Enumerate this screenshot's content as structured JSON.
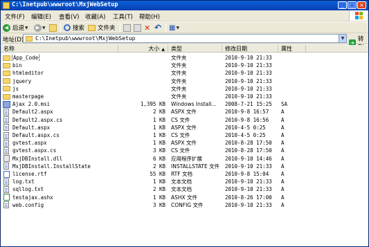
{
  "window": {
    "title": "C:\\Inetpub\\wwwroot\\MxjWebSetup",
    "minimize_glyph": "_",
    "maximize_glyph": "□",
    "close_glyph": "×"
  },
  "menu": [
    "文件(F)",
    "编辑(E)",
    "查看(V)",
    "收藏(A)",
    "工具(T)",
    "帮助(H)"
  ],
  "toolbar": {
    "back_label": "后退",
    "back_glyph": "◀",
    "forward_glyph": "▶",
    "dropdown_glyph": "▼",
    "search_label": "搜索",
    "folders_label": "文件夹",
    "delete_glyph": "✕",
    "undo_glyph": "↶",
    "views_glyph": "▦"
  },
  "address": {
    "label": "地址(D)",
    "path": "C:\\Inetpub\\wwwroot\\MxjWebSetup",
    "dropdown_glyph": "▼",
    "go_label": "转到",
    "go_glyph": "➜"
  },
  "columns": {
    "name": "名称",
    "size": "大小",
    "type": "类型",
    "modified": "修改日期",
    "attributes": "属性",
    "sort_glyph": "▲"
  },
  "files": [
    {
      "icon": "folder",
      "name": "App_Code",
      "size": "",
      "type": "文件夹",
      "modified": "2010-9-10 21:33",
      "attr": ""
    },
    {
      "icon": "folder",
      "name": "bin",
      "size": "",
      "type": "文件夹",
      "modified": "2010-9-10 21:33",
      "attr": ""
    },
    {
      "icon": "folder",
      "name": "htmleditor",
      "size": "",
      "type": "文件夹",
      "modified": "2010-9-10 21:33",
      "attr": ""
    },
    {
      "icon": "folder",
      "name": "jquery",
      "size": "",
      "type": "文件夹",
      "modified": "2010-9-10 21:33",
      "attr": ""
    },
    {
      "icon": "folder",
      "name": "js",
      "size": "",
      "type": "文件夹",
      "modified": "2010-9-10 21:33",
      "attr": ""
    },
    {
      "icon": "folder",
      "name": "masterpage",
      "size": "",
      "type": "文件夹",
      "modified": "2010-9-10 21:33",
      "attr": ""
    },
    {
      "icon": "msi",
      "name": "Ajax 2.0.msi",
      "size": "1,395 KB",
      "type": "Windows Install...",
      "modified": "2008-7-21 15:25",
      "attr": "SA"
    },
    {
      "icon": "file",
      "name": "Default2.aspx",
      "size": "2 KB",
      "type": "ASPX 文件",
      "modified": "2010-9-8 16:57",
      "attr": "A"
    },
    {
      "icon": "file",
      "name": "Default2.aspx.cs",
      "size": "1 KB",
      "type": "CS 文件",
      "modified": "2010-9-8 16:56",
      "attr": "A"
    },
    {
      "icon": "file",
      "name": "Default.aspx",
      "size": "1 KB",
      "type": "ASPX 文件",
      "modified": "2010-4-5 0:25",
      "attr": "A"
    },
    {
      "icon": "file",
      "name": "Default.aspx.cs",
      "size": "1 KB",
      "type": "CS 文件",
      "modified": "2010-4-5 0:25",
      "attr": "A"
    },
    {
      "icon": "file",
      "name": "gvtest.aspx",
      "size": "1 KB",
      "type": "ASPX 文件",
      "modified": "2010-8-28 17:50",
      "attr": "A"
    },
    {
      "icon": "file",
      "name": "gvtest.aspx.cs",
      "size": "3 KB",
      "type": "CS 文件",
      "modified": "2010-8-28 17:50",
      "attr": "A"
    },
    {
      "icon": "dll",
      "name": "MxjDBInstall.dll",
      "size": "6 KB",
      "type": "应用程序扩展",
      "modified": "2010-9-10 14:46",
      "attr": "A"
    },
    {
      "icon": "file",
      "name": "MxjDBInstall.InstallState",
      "size": "2 KB",
      "type": "INSTALLSTATE 文件",
      "modified": "2010-9-10 21:33",
      "attr": "A"
    },
    {
      "icon": "rtf",
      "name": "license.rtf",
      "size": "55 KB",
      "type": "RTF 文档",
      "modified": "2010-9-8 15:04",
      "attr": "A"
    },
    {
      "icon": "file",
      "name": "log.txt",
      "size": "1 KB",
      "type": "文本文档",
      "modified": "2010-9-10 21:33",
      "attr": "A"
    },
    {
      "icon": "file",
      "name": "sqllog.txt",
      "size": "2 KB",
      "type": "文本文档",
      "modified": "2010-9-10 21:33",
      "attr": "A"
    },
    {
      "icon": "asp",
      "name": "testajax.ashx",
      "size": "1 KB",
      "type": "ASHX 文件",
      "modified": "2010-8-26 17:00",
      "attr": "A"
    },
    {
      "icon": "file",
      "name": "web.config",
      "size": "3 KB",
      "type": "CONFIG 文件",
      "modified": "2010-9-10 21:33",
      "attr": "A"
    }
  ],
  "colors": {
    "titlebar": "#0a5fd8",
    "chrome": "#ece9d8",
    "folder": "#f5d76e",
    "go_button": "#22a33a"
  }
}
